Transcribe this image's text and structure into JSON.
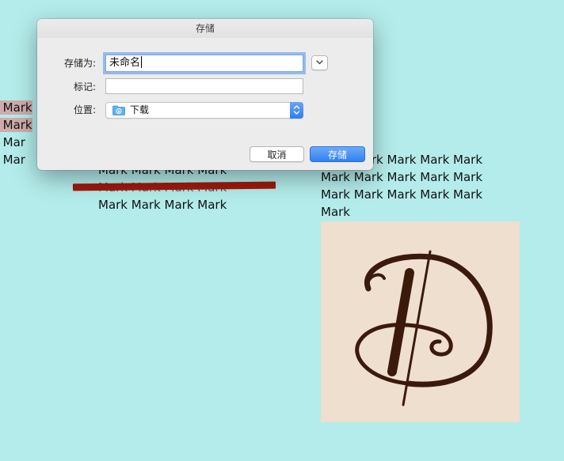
{
  "canvas": {
    "left_column": [
      "rk Mark",
      "rk Mark",
      "rk Mar",
      "rk Mar"
    ],
    "middle_column": [
      "Mark Mark Mark Mark",
      "Mark Mark Mark Mark"
    ],
    "middle_strikethrough": "Mark Mark Mark Mark",
    "right_column": [
      "Mark Mark Mark Mark Mark",
      "Mark Mark Mark Mark Mark",
      "Mark Mark Mark Mark Mark",
      "Mark"
    ],
    "image": {
      "icon": "monogram-d-icon",
      "background": "#efdfcf",
      "ink": "#3b1a0c"
    },
    "highlight_color": "#e67878",
    "strike_color": "#a0180d"
  },
  "dialog": {
    "title": "存储",
    "save_as_label": "存储为:",
    "save_as_value": "未命名",
    "tags_label": "标记:",
    "tags_value": "",
    "location_label": "位置:",
    "location_value": "下载",
    "location_icon": "downloads-folder-icon",
    "disclosure_icon": "chevron-down-icon",
    "popup_arrows_icon": "updown-arrows-icon",
    "cancel_label": "取消",
    "save_label": "存储",
    "accent_color": "#2f80f4"
  }
}
